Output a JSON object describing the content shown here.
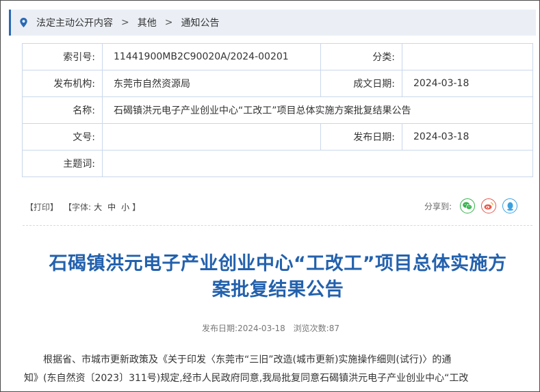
{
  "breadcrumb": {
    "items": [
      "法定主动公开内容",
      "其他",
      "通知公告"
    ],
    "separator": ">"
  },
  "info": {
    "index_label": "索引号:",
    "index_value": "11441900MB2C90020A/2024-00201",
    "category_label": "分类:",
    "category_value": "",
    "publisher_label": "发布机构:",
    "publisher_value": "东莞市自然资源局",
    "created_label": "成文日期:",
    "created_value": "2024-03-18",
    "name_label": "名称:",
    "name_value": "石碣镇洪元电子产业创业中心“工改工”项目总体实施方案批复结果公告",
    "docno_label": "文号:",
    "docno_value": "",
    "published_label": "发布日期:",
    "published_value": "2024-03-18",
    "subject_label": "主题词:",
    "subject_value": ""
  },
  "tools": {
    "print": "【打印】",
    "font_prefix": "【字体:",
    "font_large": "大",
    "font_medium": "中",
    "font_small": "小",
    "font_suffix": "】",
    "share_label": "分享到:"
  },
  "article": {
    "title_line1": "石碣镇洪元电子产业创业中心“工改工”项目总体实施方",
    "title_line2": "案批复结果公告",
    "meta_date_label": "发布日期:",
    "meta_date": "2024-03-18",
    "meta_views_label": "浏览次数:",
    "meta_views": "87",
    "body_line1": "根据省、市城市更新政策及《关于印发〈东莞市“三旧”改造(城市更新)实施操作细则(试行)〉的通",
    "body_line2": "知》(东自然资〔2023〕311号)规定,经市人民政府同意,我局批复同意石碣镇洪元电子产业创业中心“工改"
  },
  "colors": {
    "accent": "#2a69b5",
    "title": "#2361ad",
    "crumb_bg": "#ebeff5",
    "table_border": "#c9d7ea",
    "wechat": "#33b34a",
    "weibo": "#e8574a",
    "qq": "#3aa0e0"
  },
  "icons": [
    "location-pin-icon",
    "wechat-icon",
    "weibo-icon",
    "qq-icon"
  ]
}
